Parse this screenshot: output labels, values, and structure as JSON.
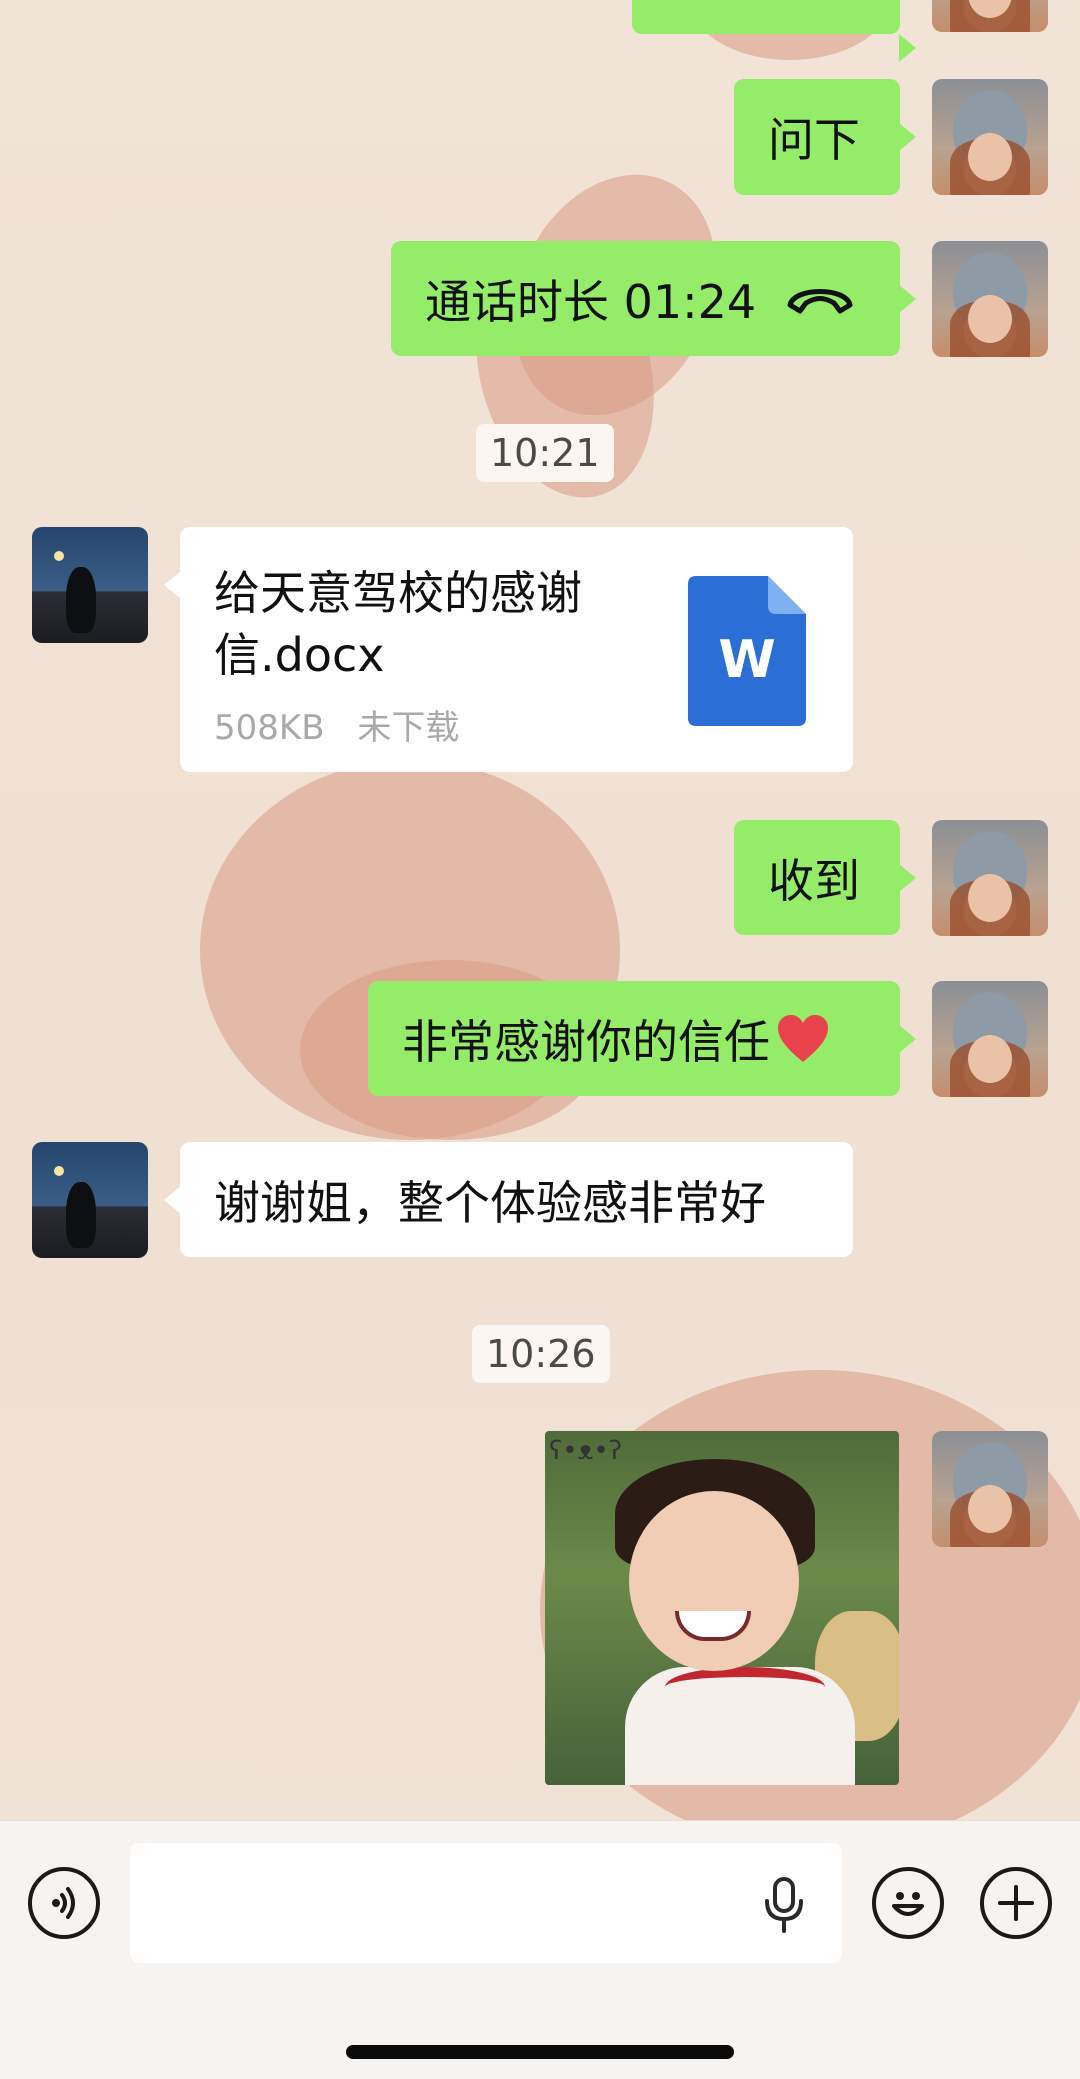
{
  "messages": {
    "m1": "问下",
    "call": {
      "label": "通话时长 01:24"
    },
    "time1": "10:21",
    "file": {
      "name": "给天意驾校的感谢信.docx",
      "size": "508KB",
      "status": "未下载",
      "icon_letter": "W"
    },
    "m2": "收到",
    "m3": "非常感谢你的信任",
    "m4": "谢谢姐，整个体验感非常好",
    "time2": "10:26"
  },
  "colors": {
    "bubble_self": "#95ec69",
    "bubble_other": "#ffffff",
    "word_blue": "#2b6fd6"
  },
  "input_bar": {
    "voice_icon": "voice-toggle-icon",
    "mic_icon": "microphone-icon",
    "emoji_icon": "emoji-icon",
    "plus_icon": "plus-icon"
  }
}
